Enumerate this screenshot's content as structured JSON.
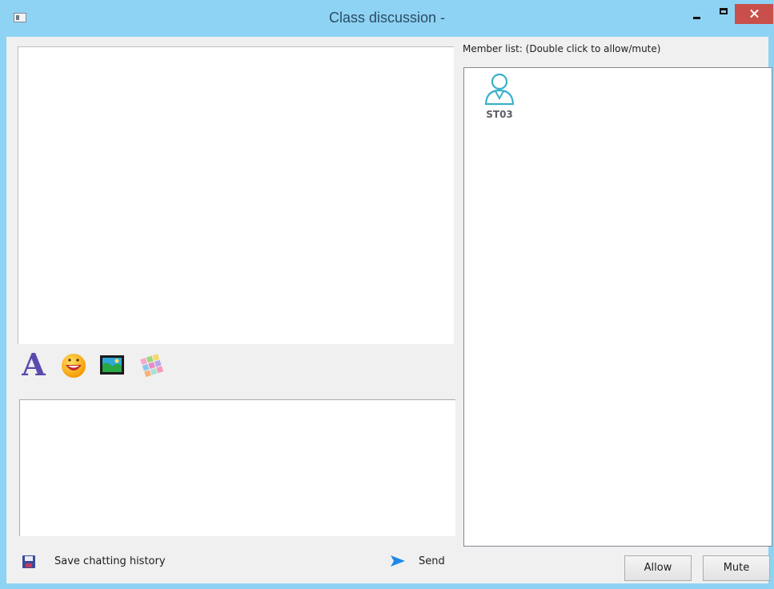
{
  "window": {
    "title": "Class discussion -"
  },
  "toolbar": {
    "icons": [
      "font-icon",
      "emoji-icon",
      "image-icon",
      "palette-icon"
    ],
    "font_glyph": "A"
  },
  "footer": {
    "save_label": "Save chatting history",
    "send_label": "Send"
  },
  "members": {
    "caption": "Member list: (Double click to allow/mute)",
    "items": [
      {
        "name": "ST03",
        "icon": "user-icon"
      }
    ]
  },
  "buttons": {
    "allow": "Allow",
    "mute": "Mute"
  },
  "colors": {
    "title_bar": "#8fd3f4",
    "close": "#c9504a",
    "send_arrow": "#1e88e5",
    "user_icon": "#3bb0c9"
  }
}
